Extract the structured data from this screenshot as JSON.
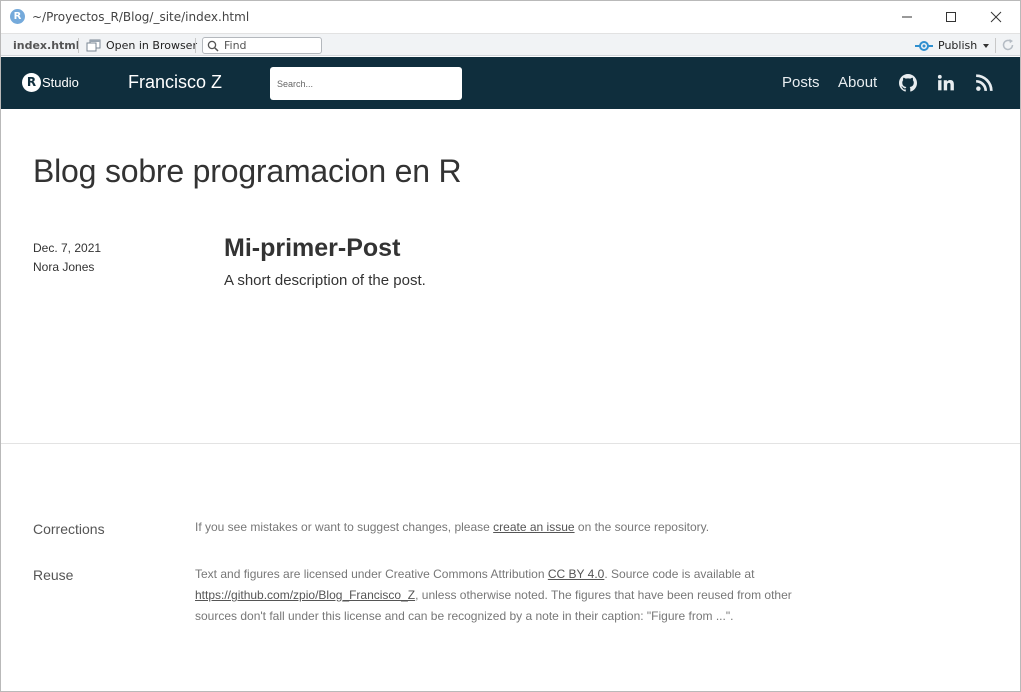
{
  "window": {
    "app_icon": "R",
    "path": "~/Proyectos_R/Blog/_site/index.html",
    "controls": [
      "minimize-icon",
      "maximize-icon",
      "close-icon"
    ]
  },
  "toolbar": {
    "tab_label": "index.html",
    "open_browser_label": "Open in Browser",
    "find_placeholder": "Find",
    "publish_label": "Publish",
    "icons": [
      "open-browser-icon",
      "search-icon",
      "publish-icon",
      "chevron-down-icon",
      "refresh-icon"
    ]
  },
  "navbar": {
    "logo_r": "R",
    "logo_text": "Studio",
    "site_title": "Francisco Z",
    "search_placeholder": "Search...",
    "links": [
      {
        "label": "Posts"
      },
      {
        "label": "About"
      }
    ],
    "icons": [
      "github-icon",
      "linkedin-icon",
      "rss-icon"
    ],
    "colors": {
      "background": "#0f2e3d",
      "text": "#ffffff"
    }
  },
  "main": {
    "title": "Blog sobre programacion en R",
    "posts": [
      {
        "date": "Dec. 7, 2021",
        "author": "Nora Jones",
        "title": "Mi-primer-Post",
        "description": "A short description of the post."
      }
    ]
  },
  "appendix": {
    "corrections": {
      "heading": "Corrections",
      "text_before": "If you see mistakes or want to suggest changes, please ",
      "link": "create an issue",
      "text_after": " on the source repository."
    },
    "reuse": {
      "heading": "Reuse",
      "text_before": "Text and figures are licensed under Creative Commons Attribution ",
      "link1": "CC BY 4.0",
      "text_mid": ". Source code is available at ",
      "link2": "https://github.com/zpio/Blog_Francisco_Z",
      "text_after": ", unless otherwise noted. The figures that have been reused from other sources don't fall under this license and can be recognized by a note in their caption: \"Figure from ...\"."
    }
  }
}
